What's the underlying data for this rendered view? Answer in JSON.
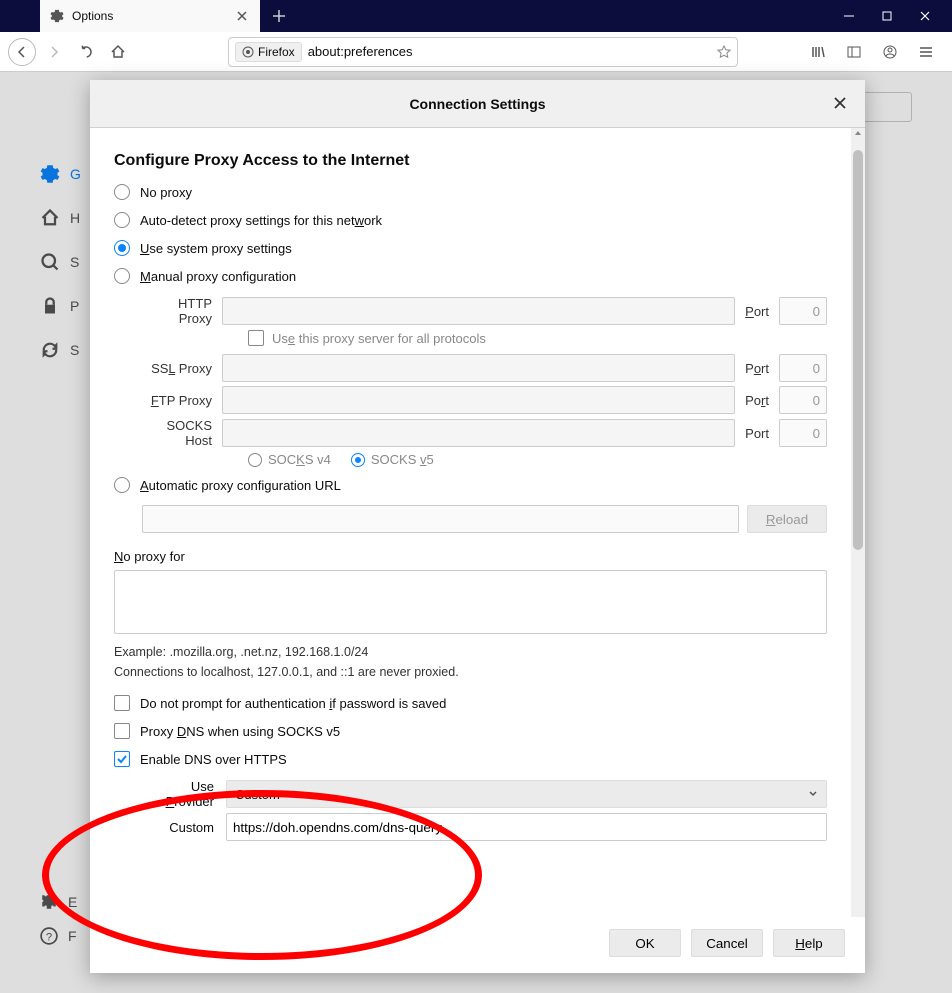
{
  "tab": {
    "title": "Options"
  },
  "addressbar": {
    "prefix_icon": "firefox",
    "prefix_label": "Firefox",
    "url": "about:preferences"
  },
  "sidebar": {
    "items": [
      {
        "label": "G"
      },
      {
        "label": "H"
      },
      {
        "label": "S"
      },
      {
        "label": "P"
      },
      {
        "label": "S"
      }
    ],
    "bottom": [
      {
        "label": "E"
      },
      {
        "label": "F"
      }
    ]
  },
  "modal": {
    "title": "Connection Settings",
    "section_title": "Configure Proxy Access to the Internet",
    "radios": {
      "no_proxy": "No proxy",
      "auto_detect_pre": "Auto-detect proxy settings for this net",
      "auto_detect_u": "w",
      "auto_detect_post": "ork",
      "use_system_pre": "",
      "use_system_u": "U",
      "use_system_post": "se system proxy settings",
      "manual_pre": "",
      "manual_u": "M",
      "manual_post": "anual proxy configuration",
      "auto_url_pre": "",
      "auto_url_u": "A",
      "auto_url_post": "utomatic proxy configuration URL"
    },
    "proxy": {
      "http_label": "HTTP Proxy",
      "http_port_u": "P",
      "http_port": "ort",
      "use_all_pre": "Us",
      "use_all_u": "e",
      "use_all_post": " this proxy server for all protocols",
      "ssl_label_pre": "SS",
      "ssl_label_u": "L",
      "ssl_label_post": " Proxy",
      "ssl_port_u": "o",
      "ssl_port_pre": "P",
      "ssl_port_post": "rt",
      "ftp_label_u": "F",
      "ftp_label_post": "TP Proxy",
      "ftp_port_pre": "Po",
      "ftp_port_u": "r",
      "ftp_port_post": "t",
      "socks_label": "SOCKS Host",
      "socks_port": "Port",
      "port_value": "0",
      "socks_v4_pre": "SOC",
      "socks_v4_u": "K",
      "socks_v4_post": "S v4",
      "socks_v5_pre": "SOCKS ",
      "socks_v5_u": "v",
      "socks_v5_post": "5"
    },
    "reload_u": "R",
    "reload_pre": "",
    "reload_post": "eload",
    "noproxy_label_u": "N",
    "noproxy_label_post": "o proxy for",
    "example": "Example: .mozilla.org, .net.nz, 192.168.1.0/24",
    "localhost_note": "Connections to localhost, 127.0.0.1, and ::1 are never proxied.",
    "checks": {
      "no_prompt_pre": "Do not prompt for authentication ",
      "no_prompt_u": "i",
      "no_prompt_post": "f password is saved",
      "proxy_dns_pre": "Proxy ",
      "proxy_dns_u": "D",
      "proxy_dns_post": "NS when using SOCKS v5",
      "enable_doh": "Enable DNS over HTTPS"
    },
    "provider": {
      "label_pre": "Use ",
      "label_u": "P",
      "label_post": "rovider",
      "value": "Custom",
      "custom_label": "Custom",
      "custom_value": "https://doh.opendns.com/dns-query"
    },
    "buttons": {
      "ok": "OK",
      "cancel": "Cancel",
      "help_u": "H",
      "help_post": "elp"
    }
  }
}
